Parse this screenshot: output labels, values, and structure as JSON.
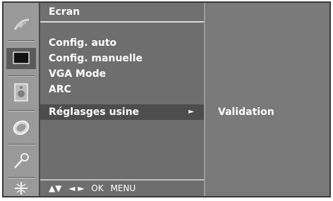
{
  "menu": {
    "header": "Ecran",
    "items": [
      {
        "label": "Config. auto"
      },
      {
        "label": "Config. manuelle"
      },
      {
        "label": "VGA Mode"
      },
      {
        "label": "ARC"
      },
      {
        "label": "Réglasges usine",
        "arrow": "►"
      }
    ],
    "footer": {
      "nav_up_down": "▲▼",
      "nav_left_right": "◄ ►",
      "ok": "OK",
      "menu": "MENU"
    }
  },
  "submenu": {
    "items": [
      {
        "label": "Validation"
      }
    ]
  },
  "icons": [
    {
      "name": "satellite-dish-icon"
    },
    {
      "name": "screen-icon"
    },
    {
      "name": "speaker-icon"
    },
    {
      "name": "clock-icon"
    },
    {
      "name": "key-icon"
    },
    {
      "name": "network-icon"
    }
  ]
}
